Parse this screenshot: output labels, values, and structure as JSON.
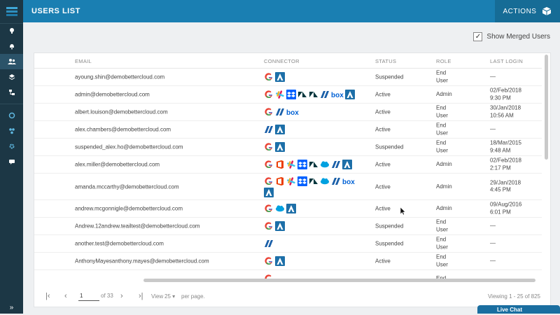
{
  "header": {
    "title": "USERS LIST",
    "actions_label": "ACTIONS"
  },
  "merge_toggle": {
    "label": "Show Merged Users",
    "checked": true
  },
  "table": {
    "columns": [
      "EMAIL",
      "CONNECTOR",
      "STATUS",
      "ROLE",
      "LAST LOGIN"
    ],
    "rows": [
      {
        "email": "ayoung.shin@demobettercloud.com",
        "connectors": [
          "google",
          "atlassian"
        ],
        "status": "Suspended",
        "role": "End\nUser",
        "last_login": "—"
      },
      {
        "email": "admin@demobettercloud.com",
        "connectors": [
          "google",
          "slack",
          "dropbox",
          "zendesk",
          "zendesk",
          "dfs",
          "box",
          "atlassian"
        ],
        "status": "Active",
        "role": "Admin",
        "last_login": "02/Feb/2018\n9:30 PM"
      },
      {
        "email": "albert.louison@demobettercloud.com",
        "connectors": [
          "google",
          "dfs",
          "box"
        ],
        "status": "Active",
        "role": "End\nUser",
        "last_login": "30/Jan/2018\n10:56 AM"
      },
      {
        "email": "alex.chambers@demobettercloud.com",
        "connectors": [
          "dfs",
          "atlassian"
        ],
        "status": "Active",
        "role": "End\nUser",
        "last_login": "—"
      },
      {
        "email": "suspended_alex.ho@demobettercloud.com",
        "connectors": [
          "google",
          "atlassian"
        ],
        "status": "Suspended",
        "role": "End\nUser",
        "last_login": "18/Mar/2015\n9:48 AM"
      },
      {
        "email": "alex.miller@demobettercloud.com",
        "connectors": [
          "google",
          "office",
          "slack",
          "dropbox",
          "zendesk",
          "salesforce",
          "dfs",
          "atlassian"
        ],
        "status": "Active",
        "role": "Admin",
        "last_login": "02/Feb/2018\n2:17 PM"
      },
      {
        "email": "amanda.mccarthy@demobettercloud.com",
        "connectors": [
          "google",
          "office",
          "slack",
          "dropbox",
          "zendesk",
          "salesforce",
          "dfs",
          "box",
          "atlassian"
        ],
        "status": "Active",
        "role": "Admin",
        "last_login": "29/Jan/2018\n4:45 PM"
      },
      {
        "email": "andrew.mcgonnigle@demobettercloud.com",
        "connectors": [
          "google",
          "salesforce",
          "atlassian"
        ],
        "status": "Active",
        "role": "Admin",
        "last_login": "09/Aug/2016\n6:01 PM"
      },
      {
        "email": "Andrew.12andrew.teailtest@demobettercloud.com",
        "connectors": [
          "google",
          "atlassian"
        ],
        "status": "Suspended",
        "role": "End\nUser",
        "last_login": "—"
      },
      {
        "email": "another.test@demobettercloud.com",
        "connectors": [
          "dfs"
        ],
        "status": "Suspended",
        "role": "End\nUser",
        "last_login": "—"
      },
      {
        "email": "AnthonyMayesanthony.mayes@demobettercloud.com",
        "connectors": [
          "google",
          "atlassian"
        ],
        "status": "Active",
        "role": "End\nUser",
        "last_login": "—"
      },
      {
        "email": "",
        "connectors": [
          "google"
        ],
        "status": "",
        "role": "End",
        "last_login": ""
      }
    ]
  },
  "pager": {
    "page": "1",
    "of_label": "of 33",
    "view_label": "View",
    "per_page": "25",
    "per_page_suffix": "per page.",
    "viewing": "Viewing 1 - 25 of 825"
  },
  "live_chat": {
    "label": "Live Chat"
  },
  "colors": {
    "header": "#1a7fb2",
    "sidebar": "#1c3745",
    "actions": "#166c96"
  }
}
